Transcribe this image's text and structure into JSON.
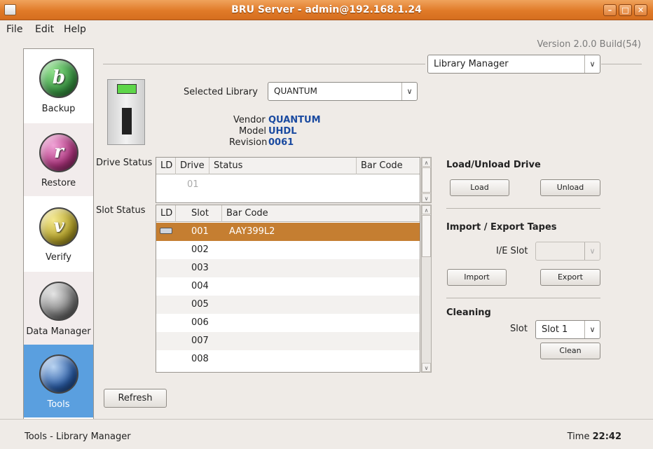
{
  "window": {
    "title": "BRU Server - admin@192.168.1.24",
    "controls": [
      "–",
      "□",
      "✕"
    ]
  },
  "menu": {
    "file": "File",
    "edit": "Edit",
    "help": "Help"
  },
  "version": "Version 2.0.0 Build(54)",
  "nav": [
    {
      "label": "Backup",
      "icon": "backup-icon",
      "glyph": "b",
      "color": "#3b9a45"
    },
    {
      "label": "Restore",
      "icon": "restore-icon",
      "glyph": "r",
      "color": "#b0357f"
    },
    {
      "label": "Verify",
      "icon": "verify-icon",
      "glyph": "v",
      "color": "#b8a52a"
    },
    {
      "label": "Data Manager",
      "icon": "data-manager-icon",
      "glyph": "",
      "color": "#7d7d7d"
    },
    {
      "label": "Tools",
      "icon": "tools-icon",
      "glyph": "",
      "color": "#2b5ea8",
      "selected": true
    }
  ],
  "manager_select": "Library Manager",
  "library": {
    "selected_label": "Selected Library",
    "selected_value": "QUANTUM",
    "vendor_label": "Vendor",
    "vendor": "QUANTUM",
    "model_label": "Model",
    "model": "UHDL",
    "revision_label": "Revision",
    "revision": "0061"
  },
  "drive_status": {
    "label": "Drive Status",
    "columns": [
      "LD",
      "Drive",
      "Status",
      "Bar Code"
    ],
    "rows": [
      {
        "ld": "",
        "drive": "01",
        "status": "",
        "barcode": ""
      }
    ]
  },
  "slot_status": {
    "label": "Slot Status",
    "columns": [
      "LD",
      "Slot",
      "Bar Code"
    ],
    "rows": [
      {
        "slot": "001",
        "barcode": "AAY399L2",
        "selected": true,
        "loaded": true
      },
      {
        "slot": "002",
        "barcode": ""
      },
      {
        "slot": "003",
        "barcode": ""
      },
      {
        "slot": "004",
        "barcode": ""
      },
      {
        "slot": "005",
        "barcode": ""
      },
      {
        "slot": "006",
        "barcode": ""
      },
      {
        "slot": "007",
        "barcode": ""
      },
      {
        "slot": "008",
        "barcode": ""
      }
    ]
  },
  "load_unload": {
    "title": "Load/Unload Drive",
    "load": "Load",
    "unload": "Unload"
  },
  "import_export": {
    "title": "Import / Export Tapes",
    "ie_slot_label": "I/E Slot",
    "ie_slot_value": "",
    "import": "Import",
    "export": "Export"
  },
  "cleaning": {
    "title": "Cleaning",
    "slot_label": "Slot",
    "slot_value": "Slot 1",
    "clean": "Clean"
  },
  "refresh": "Refresh",
  "status": {
    "left": "Tools - Library Manager",
    "time_label": "Time",
    "time": "22:42"
  }
}
